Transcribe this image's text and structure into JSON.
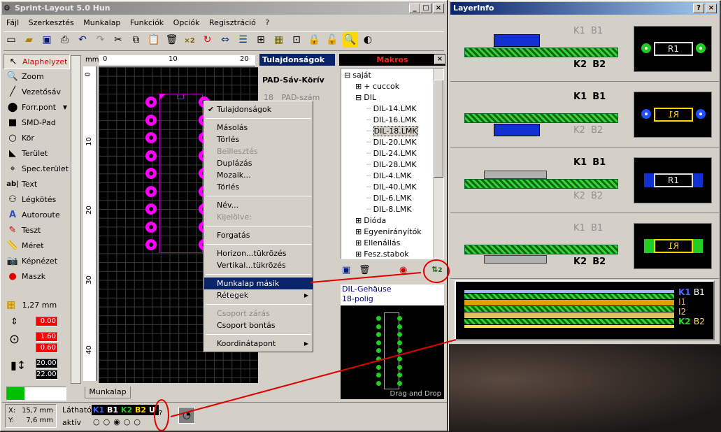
{
  "app": {
    "title": "Sprint-Layout 5.0 Hun",
    "controls": [
      "_",
      "□",
      "×"
    ]
  },
  "menu": [
    "Fájl",
    "Szerkesztés",
    "Munkalap",
    "Funkciók",
    "Opciók",
    "Regisztráció",
    "?"
  ],
  "left_tools": [
    {
      "label": "Alaphelyzet",
      "icon": "cursor-icon"
    },
    {
      "label": "Zoom",
      "icon": "magnifier-icon"
    },
    {
      "label": "Vezetősáv",
      "icon": "track-icon"
    },
    {
      "label": "Forr.pont",
      "icon": "pad-icon"
    },
    {
      "label": "SMD-Pad",
      "icon": "smd-pad-icon"
    },
    {
      "label": "Kör",
      "icon": "circle-icon"
    },
    {
      "label": "Terület",
      "icon": "area-icon"
    },
    {
      "label": "Spec.terület",
      "icon": "special-area-icon"
    },
    {
      "label": "Text",
      "icon": "text-icon"
    },
    {
      "label": "Légkötés",
      "icon": "airwire-icon"
    },
    {
      "label": "Autoroute",
      "icon": "autoroute-icon"
    },
    {
      "label": "Teszt",
      "icon": "test-icon"
    },
    {
      "label": "Méret",
      "icon": "ruler-icon"
    },
    {
      "label": "Képnézet",
      "icon": "camera-icon"
    },
    {
      "label": "Maszk",
      "icon": "mask-icon"
    }
  ],
  "grid": {
    "value": "1,27 mm"
  },
  "params": {
    "p1": "0.00",
    "p2": "1.60",
    "p3": "0.60",
    "p4": "20.00",
    "p5": "22.00"
  },
  "ruler": {
    "unit": "mm",
    "top": [
      "0",
      "10",
      "20"
    ],
    "left": [
      "0",
      "10",
      "20",
      "30",
      "40"
    ]
  },
  "tab": {
    "label": "Munkalap"
  },
  "status": {
    "x_label": "X:",
    "x_value": "15,7 mm",
    "y_label": "Y:",
    "y_value": "7,6 mm",
    "visible_label": "Látható",
    "active_label": "aktív",
    "layers": [
      "K1",
      "B1",
      "K2",
      "B2",
      "U"
    ],
    "help": "?"
  },
  "properties": {
    "title": "Tulajdonságok",
    "heading": "PAD-Sáv-Körív",
    "row_num": "18",
    "row_label": "PAD-szám"
  },
  "context_menu": {
    "items": [
      {
        "label": "Tulajdonságok",
        "check": "✔"
      },
      {
        "sep": true
      },
      {
        "label": "Másolás"
      },
      {
        "label": "Törlés"
      },
      {
        "label": "Beillesztés",
        "disabled": true
      },
      {
        "label": "Duplázás"
      },
      {
        "label": "Mozaik..."
      },
      {
        "label": "Törlés"
      },
      {
        "sep": true
      },
      {
        "label": "Név..."
      },
      {
        "label": "Kijelölve:",
        "disabled": true
      },
      {
        "sep": true
      },
      {
        "label": "Forgatás"
      },
      {
        "sep": true
      },
      {
        "label": "Horizon...tükrözés"
      },
      {
        "label": "Vertikal...tükrözés"
      },
      {
        "sep": true
      },
      {
        "label": "Munkalap másik oldalára",
        "selected": true
      },
      {
        "label": "Rétegek",
        "submenu": true
      },
      {
        "sep": true
      },
      {
        "label": "Csoport zárás",
        "disabled": true
      },
      {
        "label": "Csoport bontás"
      },
      {
        "sep": true
      },
      {
        "label": "Koordinátapont",
        "submenu": true
      }
    ]
  },
  "macros": {
    "title": "Makros",
    "tree": [
      {
        "label": "saját",
        "level": 0,
        "exp": "⊟"
      },
      {
        "label": "+ cuccok",
        "level": 1,
        "exp": "⊞"
      },
      {
        "label": "DIL",
        "level": 1,
        "exp": "⊟"
      },
      {
        "label": "DIL-14.LMK",
        "level": 2
      },
      {
        "label": "DIL-16.LMK",
        "level": 2
      },
      {
        "label": "DIL-18.LMK",
        "level": 2,
        "selected": true
      },
      {
        "label": "DIL-20.LMK",
        "level": 2
      },
      {
        "label": "DIL-24.LMK",
        "level": 2
      },
      {
        "label": "DIL-28.LMK",
        "level": 2
      },
      {
        "label": "DIL-4.LMK",
        "level": 2
      },
      {
        "label": "DIL-40.LMK",
        "level": 2
      },
      {
        "label": "DIL-6.LMK",
        "level": 2
      },
      {
        "label": "DIL-8.LMK",
        "level": 2
      },
      {
        "label": "Dióda",
        "level": 1,
        "exp": "⊞"
      },
      {
        "label": "Egyenirányítók",
        "level": 1,
        "exp": "⊞"
      },
      {
        "label": "Ellenállás",
        "level": 1,
        "exp": "⊞"
      },
      {
        "label": "Fesz.stabok",
        "level": 1,
        "exp": "⊞"
      }
    ],
    "preview_line1": "DIL-Gehäuse",
    "preview_line2": "18-polig",
    "drag_drop": "Drag and Drop",
    "swap_badge": "2"
  },
  "layerinfo": {
    "title": "LayerInfo",
    "controls": [
      "?",
      "×"
    ],
    "rows": [
      {
        "top": "K1",
        "top2": "B1",
        "bottom": "K2",
        "bottom2": "B2",
        "chip": "R1",
        "bold": "bottom"
      },
      {
        "top": "K1",
        "top2": "B1",
        "bottom": "K2",
        "bottom2": "B2",
        "chip": "R1",
        "bold": "top"
      },
      {
        "top": "K1",
        "top2": "B1",
        "bottom": "K2",
        "bottom2": "B2",
        "chip": "R1",
        "bold": "top"
      },
      {
        "top": "K1",
        "top2": "B1",
        "bottom": "K2",
        "bottom2": "B2",
        "chip": "R1",
        "bold": "bottom"
      }
    ],
    "stack": [
      "K1",
      "B1",
      "I1",
      "I2",
      "K2",
      "B2"
    ]
  },
  "colors": {
    "pad": "#ff00ff",
    "board": "#000000",
    "grid": "#2a2a2a",
    "title_active": "#0a246a",
    "macro_title": "#ff0000",
    "annotation": "#e00000",
    "green": "#22cc22"
  }
}
